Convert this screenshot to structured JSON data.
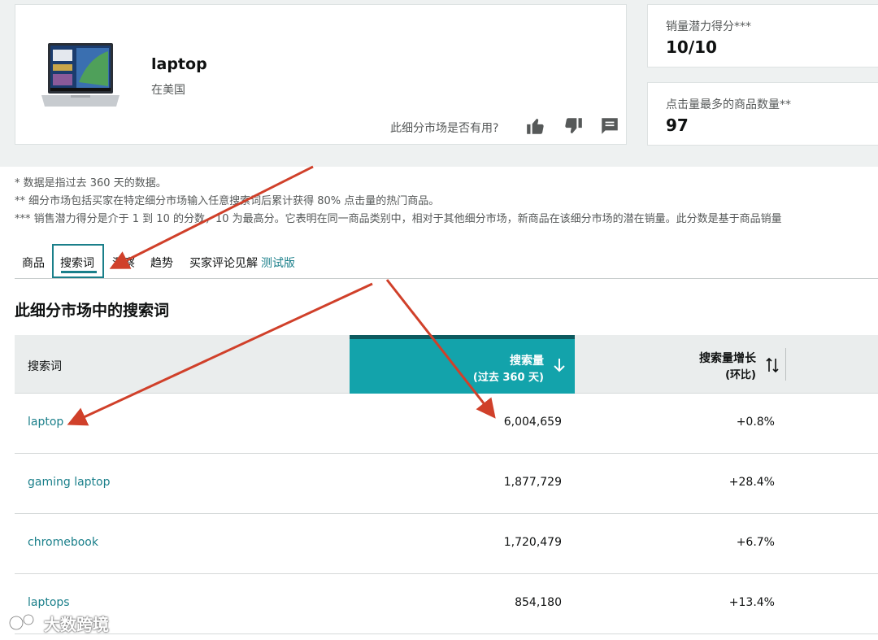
{
  "product": {
    "title": "laptop",
    "region": "在美国",
    "useful_question": "此细分市场是否有用?"
  },
  "metrics": [
    {
      "label": "销量潜力得分***",
      "value": "10/10"
    },
    {
      "label": "点击量最多的商品数量**",
      "value": "97"
    }
  ],
  "footnotes": [
    "* 数据是指过去 360 天的数据。",
    "** 细分市场包括买家在特定细分市场输入任意搜索词后累计获得 80% 点击量的热门商品。",
    "*** 销售潜力得分是介于 1 到 10 的分数，10 为最高分。它表明在同一商品类别中，相对于其他细分市场，新商品在该细分市场的潜在销量。此分数是基于商品销量"
  ],
  "tabs": [
    {
      "label": "商品"
    },
    {
      "label": "搜索词"
    },
    {
      "label": "洞察"
    },
    {
      "label": "趋势"
    },
    {
      "label": "买家评论见解",
      "badge": "测试版"
    }
  ],
  "section_title": "此细分市场中的搜索词",
  "table": {
    "headers": {
      "term": "搜索词",
      "volume_line1": "搜索量",
      "volume_line2": "(过去 360 天)",
      "growth_line1": "搜索量增长",
      "growth_line2": "(环比)"
    },
    "rows": [
      {
        "term": "laptop",
        "volume": "6,004,659",
        "growth": "+0.8%"
      },
      {
        "term": "gaming laptop",
        "volume": "1,877,729",
        "growth": "+28.4%"
      },
      {
        "term": "chromebook",
        "volume": "1,720,479",
        "growth": "+6.7%"
      },
      {
        "term": "laptops",
        "volume": "854,180",
        "growth": "+13.4%"
      }
    ]
  },
  "watermark": {
    "text": "大数跨境"
  },
  "colors": {
    "accent": "#13a3ab",
    "link": "#1a7f8a",
    "annotation_arrow": "#d0402a"
  }
}
